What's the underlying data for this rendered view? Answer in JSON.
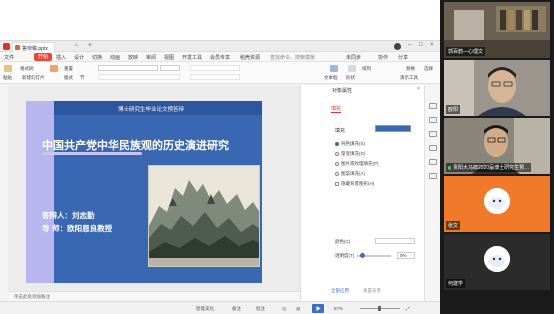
{
  "window": {
    "doc_tab": "答辩稿.pptx",
    "tab_close": "×",
    "new_tab": "+",
    "window_controls": [
      "–",
      "□",
      "×"
    ]
  },
  "ribbon": {
    "menus": [
      "文件",
      "开始",
      "插入",
      "设计",
      "切换",
      "动画",
      "放映",
      "审阅",
      "视图",
      "开发工具",
      "会员专享",
      "稻壳资源"
    ],
    "active": "开始",
    "search": "查找命令、搜索模板",
    "right_items": [
      "未同步",
      "协作",
      "分享"
    ]
  },
  "toolbar": {
    "labels": [
      "粘贴",
      "格式刷",
      "新建幻灯片",
      "版式",
      "重置",
      "节",
      "文本框",
      "形状",
      "排列",
      "演示工具",
      "替换",
      "选择"
    ]
  },
  "slide": {
    "subtitle": "博士研究生毕业论文预答辩",
    "title": "中国共产党中华民族观的历史演进研究",
    "author": "答辩人：刘志勤",
    "advisor": "导   师：欧阳恩良教授"
  },
  "notes": {
    "placeholder": "单击此处添加备注"
  },
  "pane": {
    "title": "对象属性",
    "tab": "填充",
    "section": "填充",
    "options": [
      "纯色填充(S)",
      "渐变填充(G)",
      "图片或纹理填充(P)",
      "图案填充(A)",
      "隐藏背景图形(H)"
    ],
    "selected_option": "纯色填充(S)",
    "color_label": "颜色(C)",
    "transparency_label": "透明度(T)",
    "transparency_value": "0%",
    "transparency_fraction": 0,
    "footer_left": "全部应用",
    "footer_right": "重置背景",
    "fill_color": "#3a67b2"
  },
  "statusbar": {
    "smart_beautify": "智能美化",
    "notes": "备注",
    "comments": "批注",
    "zoom": "87%"
  },
  "gallery": {
    "participants": [
      {
        "name": "郭百鹤—心理文",
        "mic": false
      },
      {
        "name": "欧阳",
        "mic": false
      },
      {
        "name": "贵阳大马郎2020届博士研究生预…",
        "mic": true
      },
      {
        "name": "张文",
        "mic": false
      },
      {
        "name": "何建学",
        "mic": false
      }
    ]
  },
  "colors": {
    "accent_red": "#e9473b",
    "slide_blue": "#3a67b2",
    "slide_lavender": "#b9b5ee",
    "tile_orange": "#f07a2a"
  }
}
